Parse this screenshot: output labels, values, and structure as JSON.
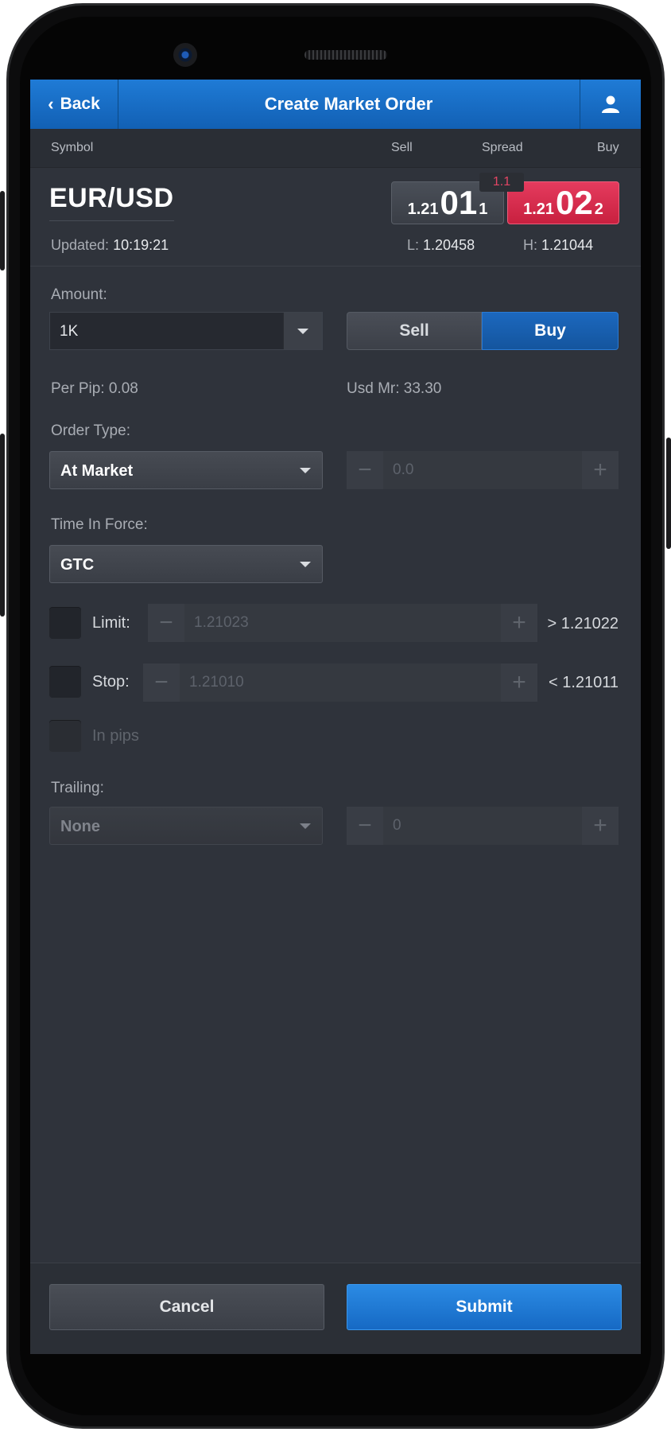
{
  "header": {
    "back_label": "Back",
    "title": "Create Market Order"
  },
  "columns": {
    "symbol": "Symbol",
    "sell": "Sell",
    "spread": "Spread",
    "buy": "Buy"
  },
  "instrument": {
    "symbol": "EUR/USD",
    "updated_label": "Updated:",
    "updated_time": "10:19:21",
    "sell_quote": {
      "prefix": "1.21",
      "big": "01",
      "suffix": "1"
    },
    "buy_quote": {
      "prefix": "1.21",
      "big": "02",
      "suffix": "2"
    },
    "spread": "1.1",
    "low_label": "L:",
    "low": "1.20458",
    "high_label": "H:",
    "high": "1.21044"
  },
  "amount": {
    "label": "Amount:",
    "value": "1K"
  },
  "side": {
    "sell_label": "Sell",
    "buy_label": "Buy",
    "selected": "Buy"
  },
  "info": {
    "per_pip": "Per Pip: 0.08",
    "usd_mr": "Usd Mr: 33.30"
  },
  "order_type": {
    "label": "Order Type:",
    "value": "At Market",
    "price": "0.0"
  },
  "time_in_force": {
    "label": "Time In Force:",
    "value": "GTC"
  },
  "limit": {
    "label": "Limit:",
    "value": "1.21023",
    "condition": "> 1.21022"
  },
  "stop": {
    "label": "Stop:",
    "value": "1.21010",
    "condition": "< 1.21011"
  },
  "in_pips": {
    "label": "In pips"
  },
  "trailing": {
    "label": "Trailing:",
    "value": "None",
    "amount": "0"
  },
  "footer": {
    "cancel_label": "Cancel",
    "submit_label": "Submit"
  },
  "colors": {
    "header_blue": "#1a6fc8",
    "buy_red": "#d42a4b",
    "background": "#2f333b",
    "submit_blue": "#1f7bd6"
  }
}
